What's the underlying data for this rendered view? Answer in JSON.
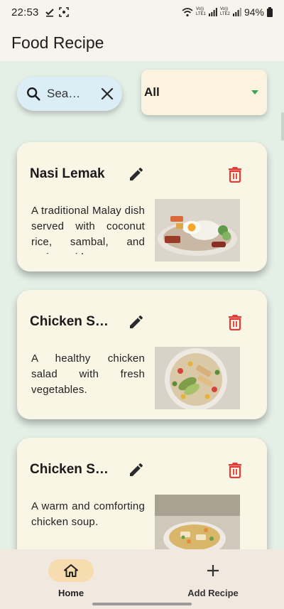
{
  "status_bar": {
    "time": "22:53",
    "battery": "94%",
    "network_label_1": "Vo)) LTE1",
    "network_label_2": "Vo)) LTE2"
  },
  "app": {
    "title": "Food Recipe"
  },
  "search": {
    "value": "Sea…"
  },
  "filter": {
    "selected": "All"
  },
  "recipes": [
    {
      "title": "Nasi Lemak",
      "description": "A traditional Malay dish served with coconut rice, sambal, and various sides",
      "image": "nasi-lemak-photo"
    },
    {
      "title": "Chicken Sa...",
      "description": "A healthy chicken salad with fresh vegetables.",
      "image": "chicken-salad-photo"
    },
    {
      "title": "Chicken So...",
      "description": "A warm and comforting chicken soup.",
      "image": "chicken-soup-photo"
    }
  ],
  "nav": {
    "home_label": "Home",
    "add_label": "Add Recipe"
  },
  "colors": {
    "background": "#e4efe6",
    "card": "#faf6e6",
    "search": "#dbeef5",
    "filter": "#fbf3dd",
    "delete": "#e53935",
    "nav_active": "#f6dcae",
    "dropdown_caret": "#3aa35a"
  },
  "icons": [
    "search-icon",
    "clear-icon",
    "edit-icon",
    "delete-icon",
    "home-icon",
    "add-icon",
    "wifi-icon",
    "signal-icon",
    "battery-icon"
  ]
}
